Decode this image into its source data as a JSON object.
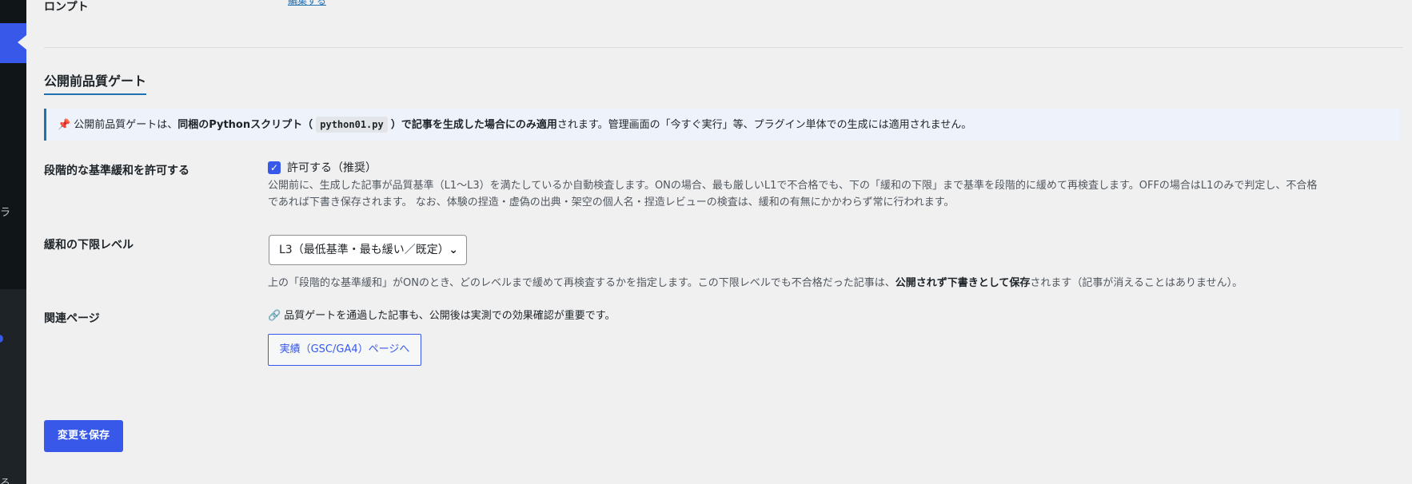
{
  "sidebar": {
    "fragment_top": "ラ",
    "fragment_bottom": "ろ"
  },
  "settings": {
    "prompt_label": "ロンプト",
    "top_link": "編集する"
  },
  "section": {
    "title": "公開前品質ゲート"
  },
  "notice": {
    "icon": "pin-icon",
    "part1": "公開前品質ゲートは、",
    "bold1": "同梱のPythonスクリプト（",
    "code": "python01.py",
    "bold2": "）で記事を生成した場合にのみ適用",
    "part2": "されます。管理画面の「今すぐ実行」等、プラグイン単体での生成には適用されません。"
  },
  "relax": {
    "label": "段階的な基準緩和を許可する",
    "checkbox_checked": true,
    "checkbox_label": "許可する（推奨）",
    "desc_line1": "公開前に、生成した記事が品質基準（L1〜L3）を満たしているか自動検査します。ONの場合、最も厳しいL1で不合格でも、下の「緩和の下限」まで基準を段階的に緩めて再検査します。OFFの場合はL1のみで判定し、不合格",
    "desc_line2": "であれば下書き保存されます。 なお、体験の捏造・虚偽の出典・架空の個人名・捏造レビューの検査は、緩和の有無にかかわらず常に行われます。"
  },
  "lower_limit": {
    "label": "緩和の下限レベル",
    "selected": "L3（最低基準・最も緩い／既定）",
    "desc_part1": "上の「段階的な基準緩和」がONのとき、どのレベルまで緩めて再検査するかを指定します。この下限レベルでも不合格だった記事は、",
    "desc_bold": "公開されず下書きとして保存",
    "desc_part2": "されます（記事が消えることはありません）。"
  },
  "related": {
    "label": "関連ページ",
    "icon": "link-icon",
    "text": "品質ゲートを通過した記事も、公開後は実測での効果確認が重要です。",
    "button_label": "実績（GSC/GA4）ページへ"
  },
  "footer": {
    "save_label": "変更を保存"
  },
  "colors": {
    "accent": "#3858e9",
    "link": "#2271b1",
    "background": "#f0f0f1",
    "sidebar": "#1d2327"
  }
}
